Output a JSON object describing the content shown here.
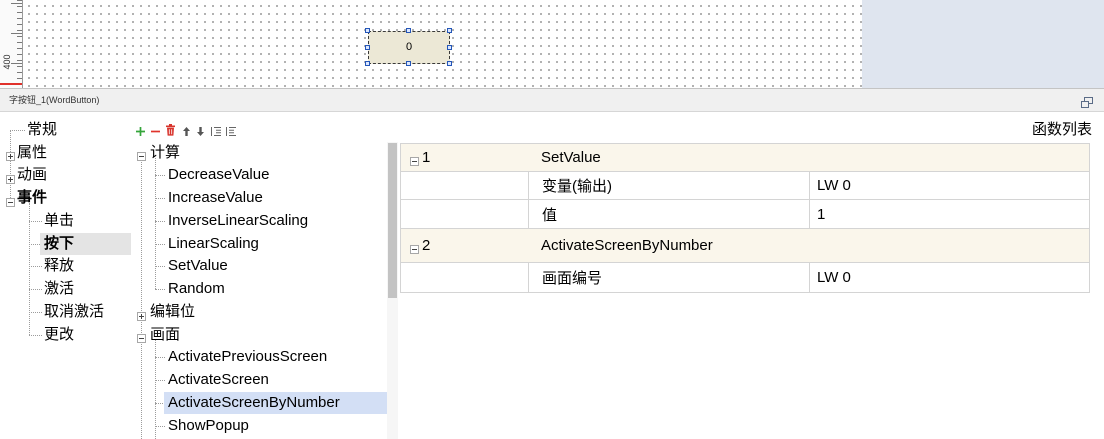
{
  "colors": {
    "canvas_bg": "#ffffff",
    "canvas_margin_bg": "#dfe5ef",
    "word_button_bg": "#ece8d6",
    "selection_handle": "#2456b8",
    "selected_event_bg": "#e4e4e4",
    "selected_function_bg": "#d3dff5",
    "function_group_row_bg": "#faf6eb",
    "add_icon": "#34a53a",
    "remove_icon": "#e0342c"
  },
  "designer": {
    "ruler_label": "400",
    "button_text": "0"
  },
  "properties_panel": {
    "title": "字按钮_1(WordButton)",
    "restore_icon": "restore-window-icon"
  },
  "category_tree": {
    "items": [
      {
        "label": "常规",
        "icon": null
      },
      {
        "label": "属性",
        "icon": "expand-icon"
      },
      {
        "label": "动画",
        "icon": "expand-icon"
      },
      {
        "label": "事件",
        "icon": "collapse-icon",
        "expanded": true
      }
    ],
    "event_items": [
      {
        "label": "单击",
        "selected": false
      },
      {
        "label": "按下",
        "selected": true
      },
      {
        "label": "释放",
        "selected": false
      },
      {
        "label": "激活",
        "selected": false
      },
      {
        "label": "取消激活",
        "selected": false
      },
      {
        "label": "更改",
        "selected": false
      }
    ]
  },
  "function_toolbar": {
    "icons": [
      "add-icon",
      "remove-icon",
      "delete-icon",
      "move-up-icon",
      "move-down-icon",
      "outdent-icon",
      "indent-icon"
    ]
  },
  "function_tree": {
    "groups": [
      {
        "label": "计算",
        "icon": "collapse-icon",
        "items": [
          {
            "label": "DecreaseValue"
          },
          {
            "label": "IncreaseValue"
          },
          {
            "label": "InverseLinearScaling"
          },
          {
            "label": "LinearScaling"
          },
          {
            "label": "SetValue"
          },
          {
            "label": "Random"
          }
        ]
      },
      {
        "label": "编辑位",
        "icon": "expand-icon",
        "items": []
      },
      {
        "label": "画面",
        "icon": "collapse-icon",
        "items": [
          {
            "label": "ActivatePreviousScreen"
          },
          {
            "label": "ActivateScreen"
          },
          {
            "label": "ActivateScreenByNumber",
            "selected": true
          },
          {
            "label": "ShowPopup"
          }
        ]
      }
    ]
  },
  "function_list": {
    "title": "函数列表",
    "entries": [
      {
        "index": "1",
        "icon": "collapse-icon",
        "name": "SetValue",
        "params": [
          {
            "name": "变量(输出)",
            "value": "LW 0"
          },
          {
            "name": "值",
            "value": "1"
          }
        ]
      },
      {
        "index": "2",
        "icon": "collapse-icon",
        "name": "ActivateScreenByNumber",
        "params": [
          {
            "name": "画面编号",
            "value": "LW 0"
          }
        ]
      }
    ]
  }
}
